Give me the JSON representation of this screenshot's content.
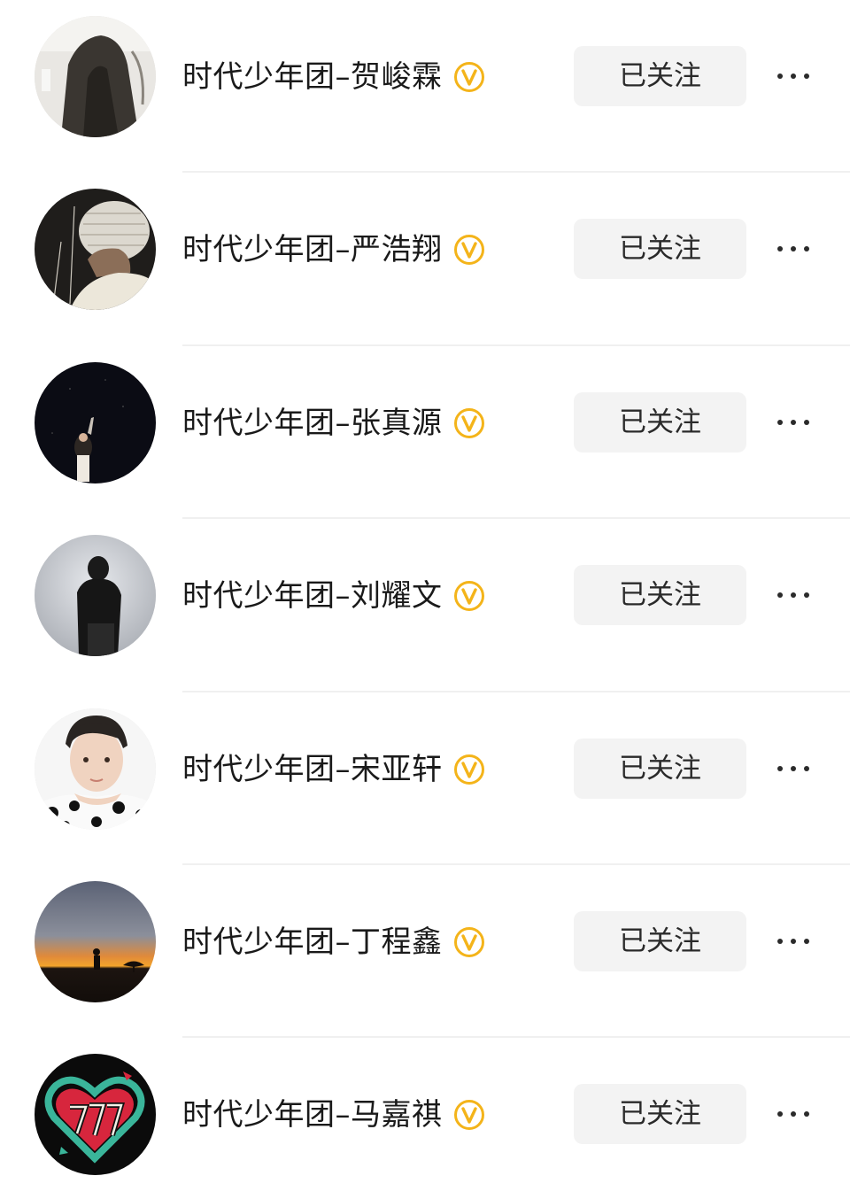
{
  "following_list": [
    {
      "name": "时代少年团–贺峻霖",
      "verified_icon": "gold-v-badge-icon",
      "follow_label": "已关注",
      "more_icon": "ellipsis-icon",
      "avatar_icon": "avatar-dark-figure"
    },
    {
      "name": "时代少年团–严浩翔",
      "verified_icon": "gold-v-badge-icon",
      "follow_label": "已关注",
      "more_icon": "ellipsis-icon",
      "avatar_icon": "avatar-knit-hat"
    },
    {
      "name": "时代少年团–张真源",
      "verified_icon": "gold-v-badge-icon",
      "follow_label": "已关注",
      "more_icon": "ellipsis-icon",
      "avatar_icon": "avatar-stage-dark"
    },
    {
      "name": "时代少年团–刘耀文",
      "verified_icon": "gold-v-badge-icon",
      "follow_label": "已关注",
      "more_icon": "ellipsis-icon",
      "avatar_icon": "avatar-silhouette-grey"
    },
    {
      "name": "时代少年团–宋亚轩",
      "verified_icon": "gold-v-badge-icon",
      "follow_label": "已关注",
      "more_icon": "ellipsis-icon",
      "avatar_icon": "avatar-portrait-polka"
    },
    {
      "name": "时代少年团–丁程鑫",
      "verified_icon": "gold-v-badge-icon",
      "follow_label": "已关注",
      "more_icon": "ellipsis-icon",
      "avatar_icon": "avatar-sunset"
    },
    {
      "name": "时代少年团–马嘉祺",
      "verified_icon": "gold-v-badge-icon",
      "follow_label": "已关注",
      "more_icon": "ellipsis-icon",
      "avatar_icon": "avatar-heart-logo"
    }
  ],
  "colors": {
    "verified_badge": "#f4b41a",
    "button_bg": "#f3f3f3",
    "text": "#1a1a1a",
    "divider": "#f0f0f0"
  }
}
